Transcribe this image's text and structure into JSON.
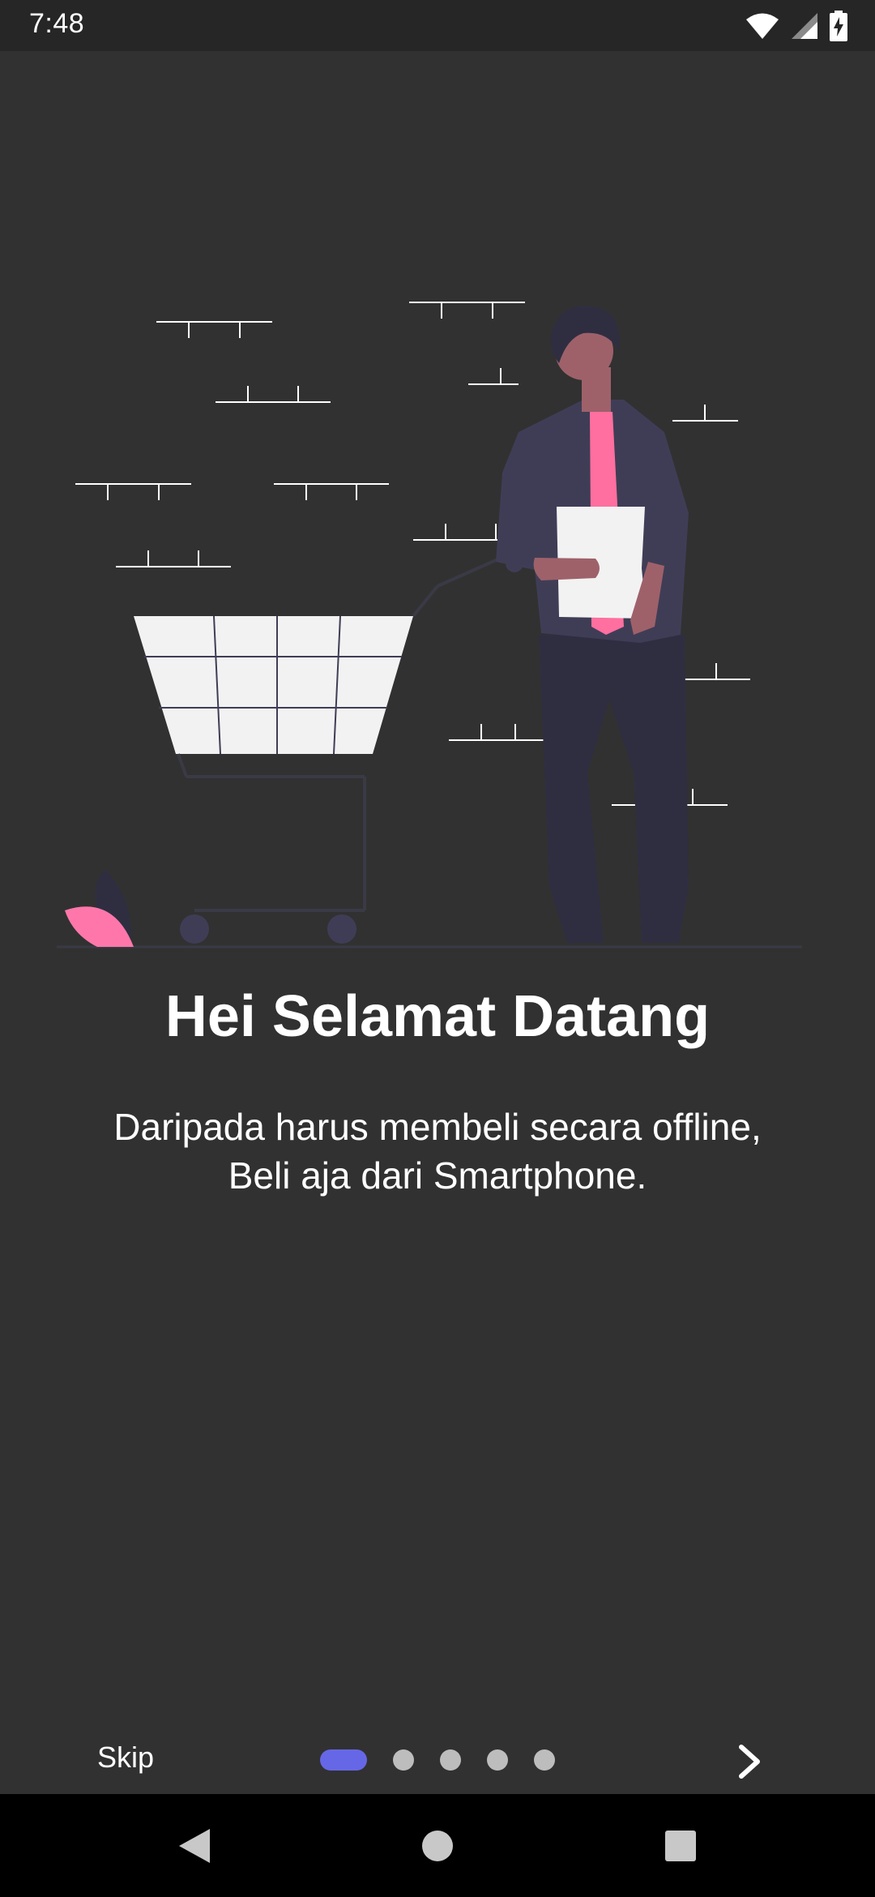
{
  "status_bar": {
    "time": "7:48",
    "icons": [
      "wifi-icon",
      "signal-icon",
      "battery-charging-icon"
    ]
  },
  "illustration": {
    "subject": "shopping-cart-person-illustration",
    "colors": {
      "cart": "#f2f2f2",
      "shirt": "#ff6f9f",
      "jacket": "#3f3d56",
      "pants": "#2f2e41",
      "skin": "#9e616a",
      "leaf": "#ff77aa"
    }
  },
  "onboarding": {
    "title": "Hei Selamat Datang",
    "subtitle_line1": "Daripada harus membeli secara offline,",
    "subtitle_line2": "Beli aja dari Smartphone."
  },
  "controls": {
    "skip_label": "Skip",
    "page_count": 5,
    "current_page": 1,
    "next_icon": "chevron-right-icon",
    "active_dot_color": "#6667e6",
    "inactive_dot_color": "#bdbdbd"
  },
  "nav_bar": {
    "buttons": [
      "back-icon",
      "home-icon",
      "recents-icon"
    ]
  }
}
